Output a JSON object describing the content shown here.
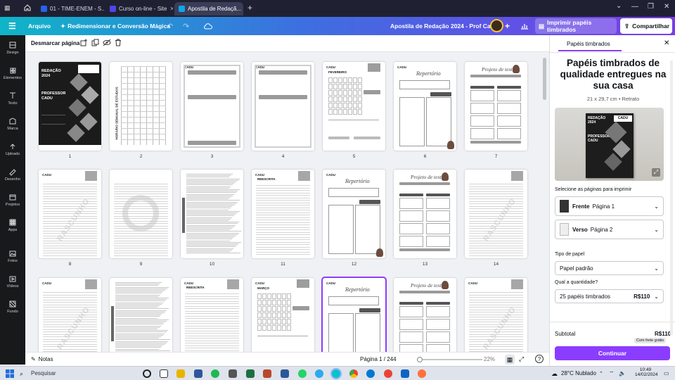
{
  "browser": {
    "tabs": [
      {
        "label": "01 - TIME-ENEM - S...",
        "color": "#2563eb"
      },
      {
        "label": "Curso on-line - Site",
        "color": "#4f46e5"
      },
      {
        "label": "Apostila de Redaçã...",
        "color": "#0ea5e9"
      }
    ]
  },
  "header": {
    "file_label": "Arquivo",
    "magic_label": "Redimensionar e Conversão Mágica",
    "doc_title": "Apostila de Redação 2024 - Prof Cadu",
    "print_label": "Imprimir papéis timbrados",
    "share_label": "Compartilhar"
  },
  "rail": [
    "Design",
    "Elementos",
    "Texto",
    "Marca",
    "Uploads",
    "Desenho",
    "Projetos",
    "Apps",
    "Fotos",
    "Vídeos",
    "Fundo"
  ],
  "toolbar": {
    "deselect_label": "Desmarcar página"
  },
  "pages": [
    {
      "n": "1",
      "t": "cover",
      "cover_title": "REDAÇÃO 2024",
      "cover_name": "PROFESSOR CADU"
    },
    {
      "n": "2",
      "t": "schedule",
      "vertical_title": "HORÁRIO SEMANAL DE ESTUDOS"
    },
    {
      "n": "3",
      "t": "frame",
      "brand": "CADU"
    },
    {
      "n": "4",
      "t": "frame2",
      "brand": "CADU"
    },
    {
      "n": "5",
      "t": "calendar",
      "month": "FEVEREIRO",
      "brand": "CADU"
    },
    {
      "n": "6",
      "t": "rep",
      "script": "Repertório",
      "brand": "CADU"
    },
    {
      "n": "7",
      "t": "projeto",
      "script": "Projeto de texto"
    },
    {
      "n": "8",
      "t": "rascunho",
      "brand": "CADU",
      "watermark": "RASCUNHO"
    },
    {
      "n": "9",
      "t": "rascunho2"
    },
    {
      "n": "10",
      "t": "dense"
    },
    {
      "n": "11",
      "t": "reescrita",
      "brand": "CADU",
      "heading": "REESCRITA"
    },
    {
      "n": "12",
      "t": "rep",
      "script": "Repertório",
      "brand": "CADU"
    },
    {
      "n": "13",
      "t": "projeto",
      "script": "Projeto de texto"
    },
    {
      "n": "14",
      "t": "rascunho3",
      "watermark": "RASCUNHO"
    },
    {
      "n": "",
      "t": "rascunho",
      "brand": "CADU",
      "watermark": "RASCUNHO"
    },
    {
      "n": "",
      "t": "dense"
    },
    {
      "n": "",
      "t": "reescrita",
      "brand": "CADU",
      "heading": "REESCRITA"
    },
    {
      "n": "",
      "t": "calendar",
      "month": "MARÇO",
      "brand": "CADU"
    },
    {
      "n": "",
      "t": "rep",
      "script": "Repertório",
      "brand": "CADU",
      "selected": true
    },
    {
      "n": "",
      "t": "projeto",
      "script": "Projeto de texto"
    },
    {
      "n": "",
      "t": "rascunho3",
      "brand": "CADU",
      "watermark": "RASCUNHO"
    }
  ],
  "bottom": {
    "notes_label": "Notas",
    "page_indicator": "Página 1 / 244",
    "zoom": "22%"
  },
  "panel": {
    "tab_label": "Papéis timbrados",
    "heading": "Papéis timbrados de qualidade entregues na sua casa",
    "spec": "21 x 29,7 cm • Retrato",
    "select_pages_label": "Selecione as páginas para imprimir",
    "front_label": "Frente",
    "front_value": "Página 1",
    "back_label": "Verso",
    "back_value": "Página 2",
    "paper_type_label": "Tipo de papel",
    "paper_type_value": "Papel padrão",
    "qty_label": "Qual a quantidade?",
    "qty_value": "25 papéis timbrados",
    "qty_price": "R$110",
    "subtotal_label": "Subtotal",
    "subtotal_value": "R$110",
    "shipping_badge": "Com frete grátis",
    "continue_label": "Continuar",
    "preview_title": "REDAÇÃO 2024",
    "preview_name": "PROFESSOR CADU",
    "preview_brand": "CADU"
  },
  "taskbar": {
    "search_placeholder": "Pesquisar",
    "weather": "28°C  Nublado",
    "time": "10:49",
    "date": "14/02/2024"
  }
}
